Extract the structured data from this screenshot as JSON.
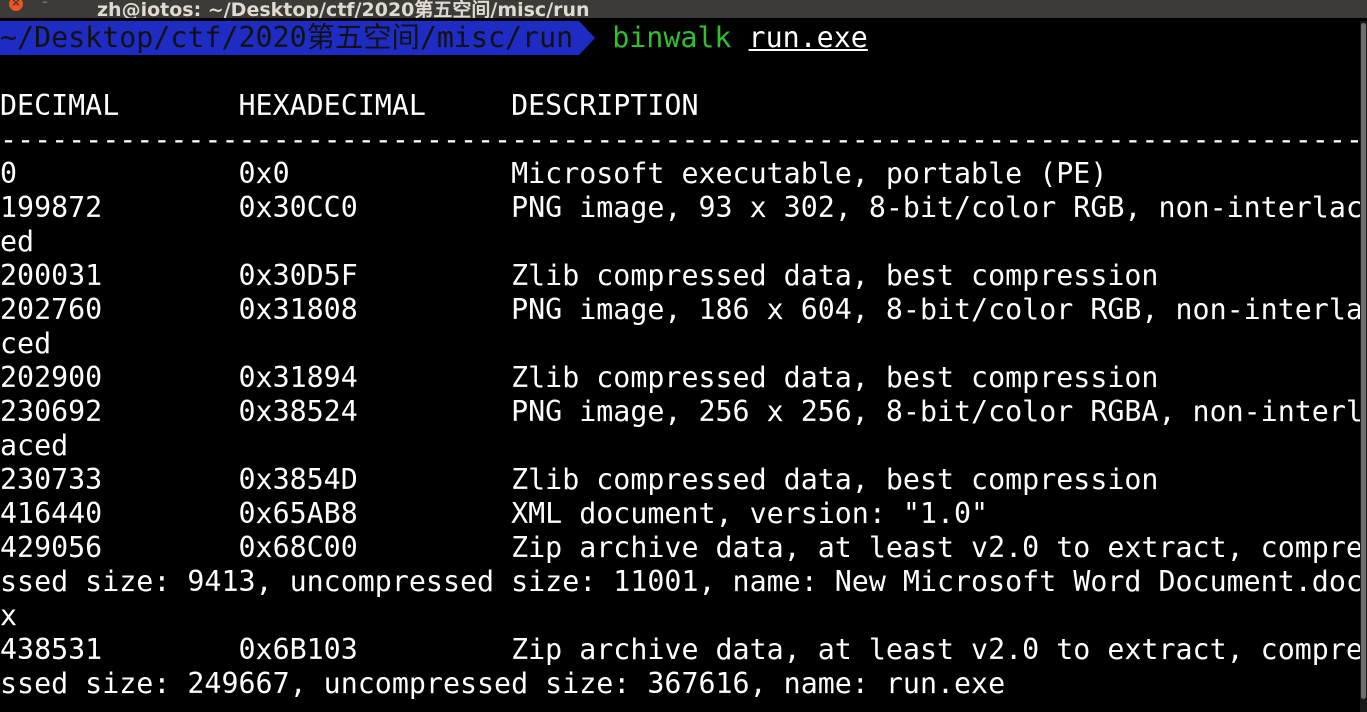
{
  "window": {
    "title": "zh@iotos: ~/Desktop/ctf/2020第五空间/misc/run",
    "close_glyph": "×",
    "minimize_glyph": "–",
    "maximize_glyph": "˄"
  },
  "prompt": {
    "path": "~/Desktop/ctf/2020第五空间/misc/run",
    "command": "binwalk",
    "argument": "run.exe"
  },
  "output": {
    "header": "DECIMAL       HEXADECIMAL     DESCRIPTION",
    "separator": "--------------------------------------------------------------------------------",
    "lines": [
      "0             0x0             Microsoft executable, portable (PE)",
      "199872        0x30CC0         PNG image, 93 x 302, 8-bit/color RGB, non-interlac",
      "ed",
      "200031        0x30D5F         Zlib compressed data, best compression",
      "202760        0x31808         PNG image, 186 x 604, 8-bit/color RGB, non-interla",
      "ced",
      "202900        0x31894         Zlib compressed data, best compression",
      "230692        0x38524         PNG image, 256 x 256, 8-bit/color RGBA, non-interl",
      "aced",
      "230733        0x3854D         Zlib compressed data, best compression",
      "416440        0x65AB8         XML document, version: \"1.0\"",
      "429056        0x68C00         Zip archive data, at least v2.0 to extract, compre",
      "ssed size: 9413, uncompressed size: 11001, name: New Microsoft Word Document.doc",
      "x",
      "438531        0x6B103         Zip archive data, at least v2.0 to extract, compre",
      "ssed size: 249667, uncompressed size: 367616, name: run.exe"
    ]
  },
  "colors": {
    "background": "#000000",
    "titlebar": "#3c3b37",
    "prompt_segment": "#1f2cc4",
    "command": "#2fbf2f",
    "text": "#ffffff"
  }
}
